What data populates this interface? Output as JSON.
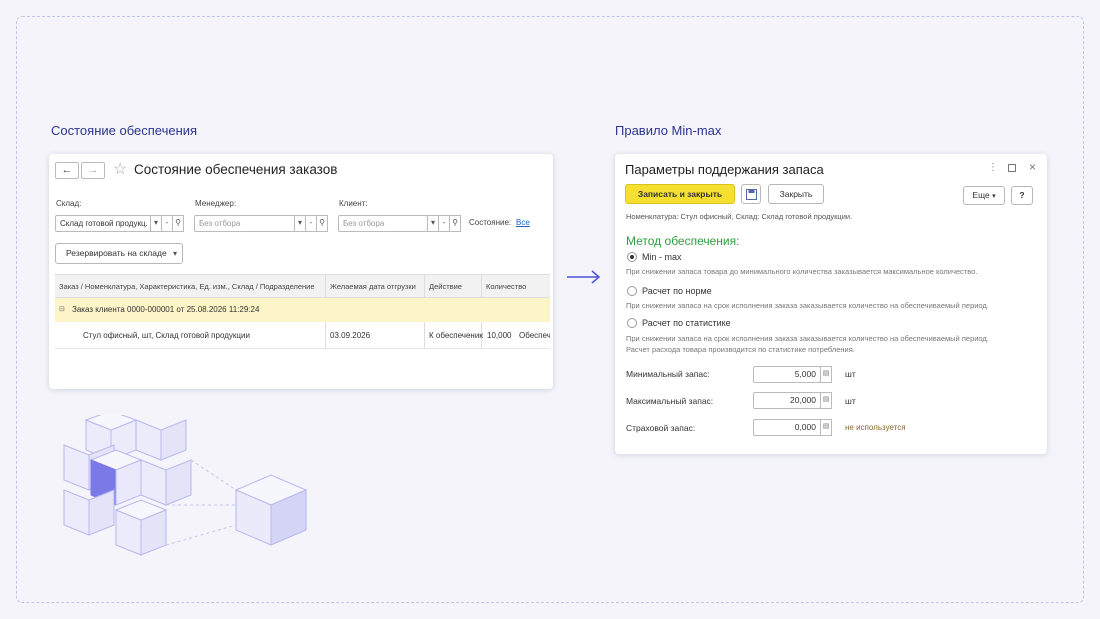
{
  "left": {
    "section_title": "Состояние обеспечения",
    "window_title": "Состояние обеспечения заказов",
    "nav": {
      "back": "←",
      "forward": "→",
      "star": "☆"
    },
    "filters": {
      "warehouse_label": "Склад:",
      "warehouse_value": "Склад готовой продукц.",
      "manager_label": "Менеджер:",
      "manager_placeholder": "Без отбора",
      "client_label": "Клиент:",
      "client_placeholder": "Без отбора",
      "state_label": "Состояние:",
      "state_value": "Все"
    },
    "reserve_button": "Резервировать на складе",
    "table": {
      "columns": [
        "Заказ / Номенклатура, Характеристика, Ед. изм., Склад / Подразделение",
        "Желаемая дата отгрузки",
        "Действие",
        "Количество"
      ],
      "group_row": "Заказ клиента 0000-000001 от 25.08.2026 11:29:24",
      "item_row": {
        "name": "Стул офисный, шт, Склад готовой продукции",
        "date": "03.09.2026",
        "action": "К обеспечению",
        "qty": "10,000",
        "extra": "Обеспеч"
      }
    }
  },
  "right": {
    "section_title": "Правило Min-max",
    "window_title": "Параметры поддержания запаса",
    "save_close_button": "Записать и закрыть",
    "close_button": "Закрыть",
    "more_button": "Еще",
    "help_button": "?",
    "nomenclature_text": "Номенклатура: Стул офисный, Склад: Склад готовой продукции.",
    "method_heading": "Метод обеспечения:",
    "options": [
      {
        "label": "Min - max",
        "selected": true,
        "desc": [
          "При снижении запаса товара до минимального количества заказывается максимальное количество."
        ]
      },
      {
        "label": "Расчет по норме",
        "selected": false,
        "desc": [
          "При снижении запаса на срок исполнения заказа заказывается количество на обеспечиваемый период."
        ]
      },
      {
        "label": "Расчет по статистике",
        "selected": false,
        "desc": [
          "При снижении запаса на срок исполнения заказа заказывается количество на обеспечиваемый период.",
          "Расчет расхода товара производится по статистике потребления."
        ]
      }
    ],
    "min_label": "Минимальный запас:",
    "min_value": "5,000",
    "max_label": "Максимальный запас:",
    "max_value": "20,000",
    "safety_label": "Страховой запас:",
    "safety_value": "0,000",
    "unit": "шт",
    "safety_note": "не используется"
  },
  "colors": {
    "accent_yellow": "#f5e031",
    "heading_green": "#2e9e3e",
    "title_blue": "#2b3490",
    "link_blue": "#2060c0",
    "arrow": "#4a55d8"
  }
}
